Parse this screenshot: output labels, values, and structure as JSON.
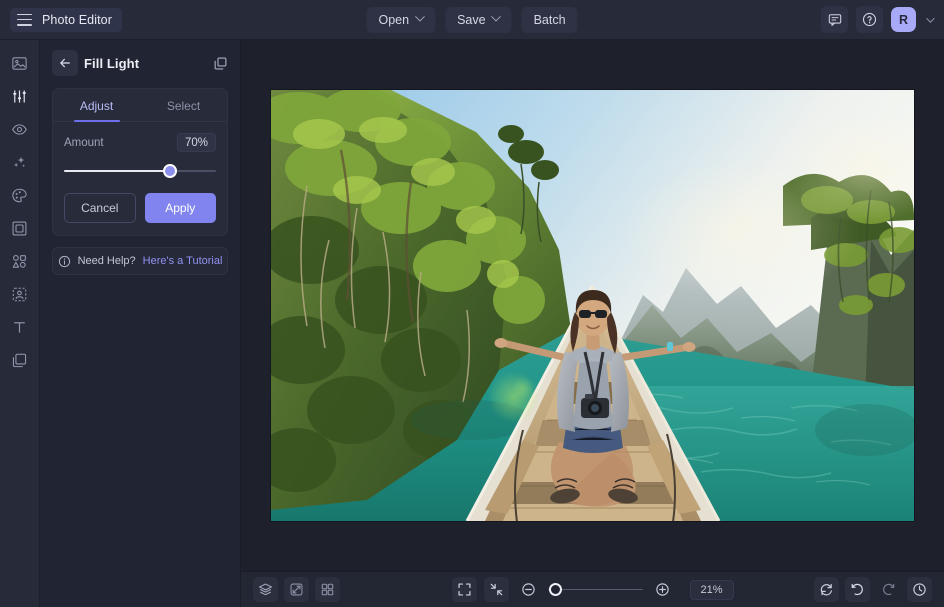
{
  "app": {
    "title": "Photo Editor",
    "accent": "#8184ee",
    "accent_light": "#a8a9f7",
    "bg_top": "#272a38",
    "bg_panel": "#212432",
    "bg_canvas": "#1e212c"
  },
  "topbar": {
    "menu_icon": "hamburger-menu-icon",
    "buttons": [
      {
        "label": "Open",
        "has_chevron": true
      },
      {
        "label": "Save",
        "has_chevron": true
      },
      {
        "label": "Batch",
        "has_chevron": false
      }
    ],
    "right_icons": [
      {
        "name": "feedback-chat-icon"
      },
      {
        "name": "help-circle-icon"
      }
    ],
    "avatar": {
      "initial": "R",
      "color": "#a8a9f7"
    }
  },
  "rail": {
    "items": [
      {
        "name": "image-icon",
        "label": "Image"
      },
      {
        "name": "adjust-sliders-icon",
        "label": "Adjust"
      },
      {
        "name": "eye-icon",
        "label": "Effects"
      },
      {
        "name": "sparkles-icon",
        "label": "Enhance"
      },
      {
        "name": "palette-icon",
        "label": "Retouch"
      },
      {
        "name": "frame-icon",
        "label": "Frames"
      },
      {
        "name": "shapes-icon",
        "label": "Elements"
      },
      {
        "name": "cutout-icon",
        "label": "Cutout"
      },
      {
        "name": "text-icon",
        "label": "Text"
      },
      {
        "name": "layers-icon",
        "label": "Layers"
      }
    ]
  },
  "panel": {
    "back_icon": "arrow-left-icon",
    "title": "Fill Light",
    "duplicate_icon": "duplicate-layers-icon",
    "tabs": [
      {
        "label": "Adjust",
        "active": true
      },
      {
        "label": "Select",
        "active": false
      }
    ],
    "amount": {
      "label": "Amount",
      "value": "70%",
      "percent": 70
    },
    "cancel_label": "Cancel",
    "apply_label": "Apply",
    "help": {
      "icon": "info-circle-icon",
      "text": "Need Help?",
      "link": "Here's a Tutorial"
    }
  },
  "canvas": {
    "photo_alt": "Woman sitting cross-legged with arms outstretched on the bow of a wooden longtail boat on turquoise water surrounded by jungle-covered limestone karst cliffs"
  },
  "bottombar": {
    "left_icons": [
      {
        "name": "layers-stack-icon"
      },
      {
        "name": "transform-flip-icon"
      },
      {
        "name": "grid-view-icon"
      }
    ],
    "view_icons": [
      {
        "name": "fit-to-screen-icon"
      },
      {
        "name": "actual-size-icon"
      }
    ],
    "zoom_out_icon": "zoom-out-icon",
    "zoom_in_icon": "zoom-in-icon",
    "zoom_value": "21%",
    "zoom_percent": 2,
    "right_icons": [
      {
        "name": "reset-icon"
      },
      {
        "name": "undo-icon"
      },
      {
        "name": "redo-icon"
      },
      {
        "name": "history-icon"
      }
    ]
  }
}
